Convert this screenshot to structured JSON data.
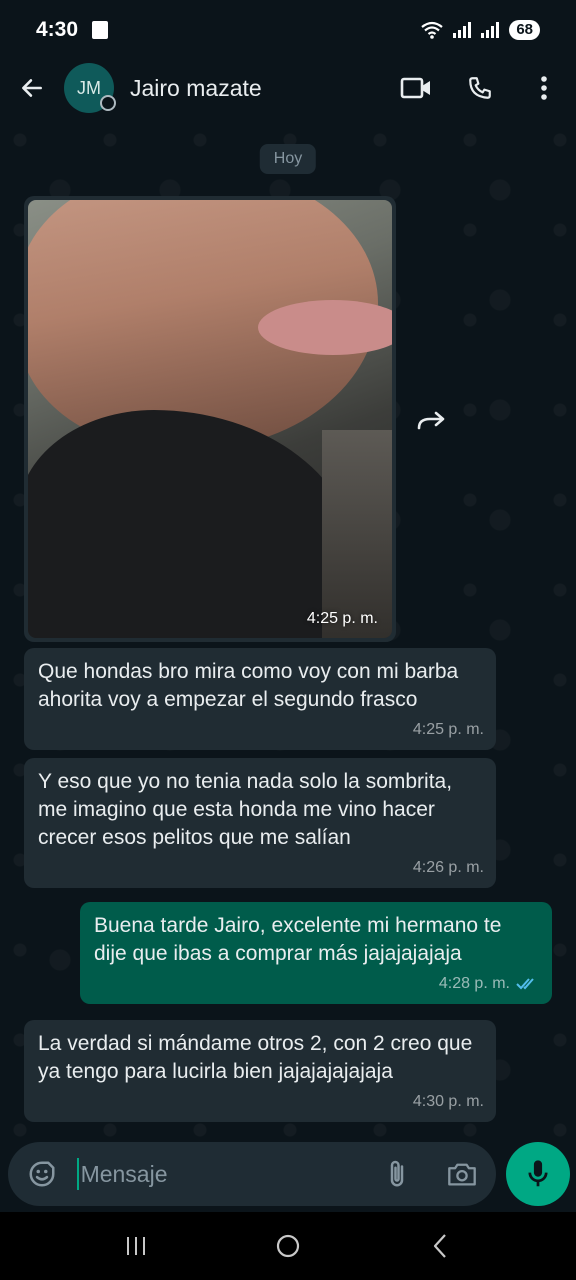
{
  "status_bar": {
    "time": "4:30",
    "battery": "68"
  },
  "header": {
    "avatar_initials": "JM",
    "contact_name": "Jairo mazate",
    "icons": [
      "back-arrow-icon",
      "video-call-icon",
      "phone-icon",
      "more-vert-icon"
    ]
  },
  "chat": {
    "date_chip": "Hoy",
    "image_message": {
      "time": "4:25 p. m."
    },
    "messages": [
      {
        "direction": "in",
        "text": "Que hondas bro mira como voy con mi barba ahorita voy a empezar el segundo frasco",
        "time": "4:25 p. m."
      },
      {
        "direction": "in",
        "text": "Y eso que yo no tenia nada solo la sombrita, me imagino que esta honda me vino hacer crecer esos pelitos que me salían",
        "time": "4:26 p. m."
      },
      {
        "direction": "out",
        "text": "Buena tarde Jairo, excelente mi hermano te dije que ibas a comprar más jajajajajaja",
        "time": "4:28 p. m."
      },
      {
        "direction": "in",
        "text": "La verdad si mándame otros 2, con 2 creo que ya tengo para lucirla bien jajajajajajaja",
        "time": "4:30 p. m."
      }
    ]
  },
  "composer": {
    "placeholder": "Mensaje"
  },
  "colors": {
    "background": "#0b141a",
    "incoming_bubble": "#202c33",
    "outgoing_bubble": "#005c4b",
    "accent": "#00a884",
    "read_ticks": "#53bdeb"
  }
}
